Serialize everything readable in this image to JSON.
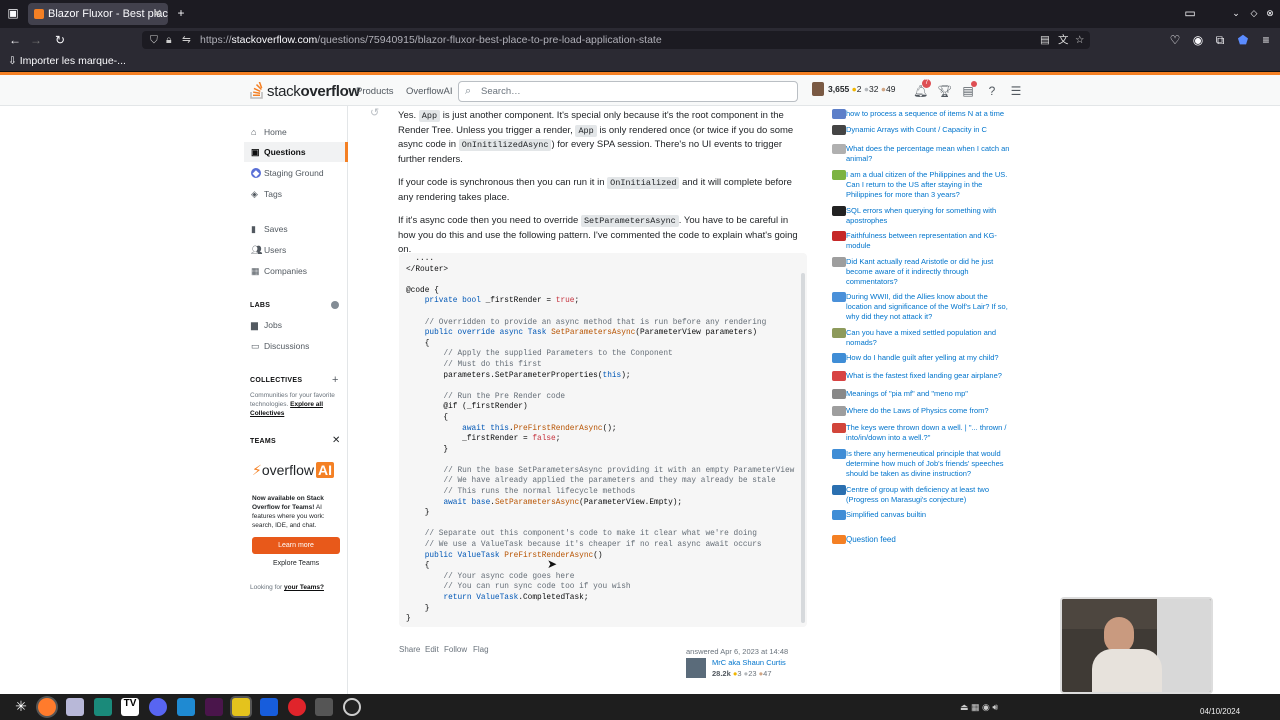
{
  "browser": {
    "tab_title": "Blazor Fluxor - Best place t",
    "url_prefix": "https://",
    "url_domain": "stackoverflow.com",
    "url_path": "/questions/75940915/blazor-fluxor-best-place-to-pre-load-application-state",
    "bookmark": "Importer les marque-..."
  },
  "header": {
    "logo_light": "stack",
    "logo_bold": "overflow",
    "products": "Products",
    "overflowai": "OverflowAI",
    "search_placeholder": "Search…",
    "reputation": "3,655",
    "gold": "2",
    "silver": "32",
    "bronze": "49",
    "inbox_badge": "7"
  },
  "leftnav": {
    "items": [
      {
        "label": "Home"
      },
      {
        "label": "Questions"
      },
      {
        "label": "Staging Ground"
      },
      {
        "label": "Tags"
      },
      {
        "label": "Saves"
      },
      {
        "label": "Users"
      },
      {
        "label": "Companies"
      },
      {
        "label": "Jobs"
      },
      {
        "label": "Discussions"
      }
    ],
    "labs": "LABS",
    "collectives": "COLLECTIVES",
    "collectives_text": "Communities for your favorite technologies.",
    "collectives_link": "Explore all Collectives",
    "teams": "TEAMS",
    "teams_brand": "overflow",
    "teams_brand_ai": "AI",
    "teams_text_bold": "Now available on Stack Overflow for Teams!",
    "teams_text": "AI features where you work: search, IDE, and chat.",
    "learn_more": "Learn more",
    "explore_teams": "Explore Teams",
    "looking_for": "Looking for",
    "your_teams": "your Teams?"
  },
  "answer": {
    "p1_a": "Yes.",
    "p1_code1": "App",
    "p1_b": "is just another component. It's special only because it's the root component in the Render Tree. Unless you trigger a render,",
    "p1_code2": "App",
    "p1_c": "is only rendered once (or twice if you do some async code in",
    "p1_code3": "OnInitilizedAsync",
    "p1_d": ") for every SPA session. There's no UI events to trigger further renders.",
    "p2_a": "If your code is synchronous then you can run it in",
    "p2_code": "OnInitialized",
    "p2_b": "and it will complete before any rendering takes place.",
    "p3_a": "If it's async code then you need to override",
    "p3_code": "SetParametersAsync",
    "p3_b": ". You have to be careful in how you do this and use the following pattern. I've commented the code to explain what's going on.",
    "share": "Share",
    "edit": "Edit",
    "follow": "Follow",
    "flag": "Flag",
    "answered": "answered Apr 6, 2023 at 14:48",
    "user_name": "MrC aka Shaun Curtis",
    "user_rep": "28.2k",
    "user_gold": "3",
    "user_silver": "23",
    "user_bronze": "47"
  },
  "code_lines": [
    "  ....",
    "</Router>",
    "",
    "@code {",
    "    private bool _firstRender = true;",
    "",
    "    // Overridden to provide an async method that is run before any rendering",
    "    public override async Task SetParametersAsync(ParameterView parameters)",
    "    {",
    "        // Apply the supplied Parameters to the Conponent",
    "        // Must do this first",
    "        parameters.SetParameterProperties(this);",
    "",
    "        // Run the Pre Render code",
    "        @if (_firstRender)",
    "        {",
    "            await this.PreFirstRenderAsync();",
    "            _firstRender = false;",
    "        }",
    "",
    "        // Run the base SetParametersAsync providing it with an empty ParameterView",
    "        // We have already applied the parameters and they may already be stale",
    "        // This runs the normal lifecycle methods",
    "        await base.SetParametersAsync(ParameterView.Empty);",
    "    }",
    "",
    "    // Separate out this component's code to make it clear what we're doing",
    "    // We use a ValueTask because it's cheaper if no real async await occurs",
    "    public ValueTask PreFirstRenderAsync()",
    "    {",
    "        // Your async code goes here",
    "        // You can run sync code too if you wish",
    "        return ValueTask.CompletedTask;",
    "    }",
    "}"
  ],
  "hot_questions": [
    {
      "text": "how to process a sequence of items N at a time",
      "color": "#5c7fc9"
    },
    {
      "text": "Dynamic Arrays with Count / Capacity in C",
      "color": "#444"
    },
    {
      "text": "What does the percentage mean when I catch an animal?",
      "color": "#b0b0b0"
    },
    {
      "text": "I am a dual citizen of the Philippines and the US. Can I return to the US after staying in the Philippines for more than 3 years?",
      "color": "#7cb342"
    },
    {
      "text": "SQL errors when querying for something with apostrophes",
      "color": "#222"
    },
    {
      "text": "Faithfulness between representation and KG-module",
      "color": "#c62828"
    },
    {
      "text": "Did Kant actually read Aristotle or did he just become aware of it indirectly through commentators?",
      "color": "#9e9e9e"
    },
    {
      "text": "During WWII, did the Allies know about the location and significance of the Wolf's Lair? If so, why did they not attack it?",
      "color": "#4a90d9"
    },
    {
      "text": "Can you have a mixed settled population and nomads?",
      "color": "#8d9a5b"
    },
    {
      "text": "How do I handle guilt after yelling at my child?",
      "color": "#3f8dd6"
    },
    {
      "text": "What is the fastest fixed landing gear airplane?",
      "color": "#d84343"
    },
    {
      "text": "Meanings of \"pia mf\" and \"meno mp\"",
      "color": "#888"
    },
    {
      "text": "Where do the Laws of Physics come from?",
      "color": "#9e9e9e"
    },
    {
      "text": "The keys were thrown down a well. | \"... thrown / into/in/down into a well.?\"",
      "color": "#d2453a"
    },
    {
      "text": "Is there any hermeneutical principle that would determine how much of Job's friends' speeches should be taken as divine instruction?",
      "color": "#3f8dd6"
    },
    {
      "text": "Centre of group with deficiency at least two (Progress on Marasugi's conjecture)",
      "color": "#2a6fb0"
    },
    {
      "text": "Simplified canvas builtin",
      "color": "#3f8dd6"
    }
  ],
  "question_feed": "Question feed",
  "taskbar": {
    "date": "04/10/2024"
  },
  "colors": {
    "accent": "#f48024",
    "link": "#0074cc",
    "learn_more": "#e8591a"
  }
}
